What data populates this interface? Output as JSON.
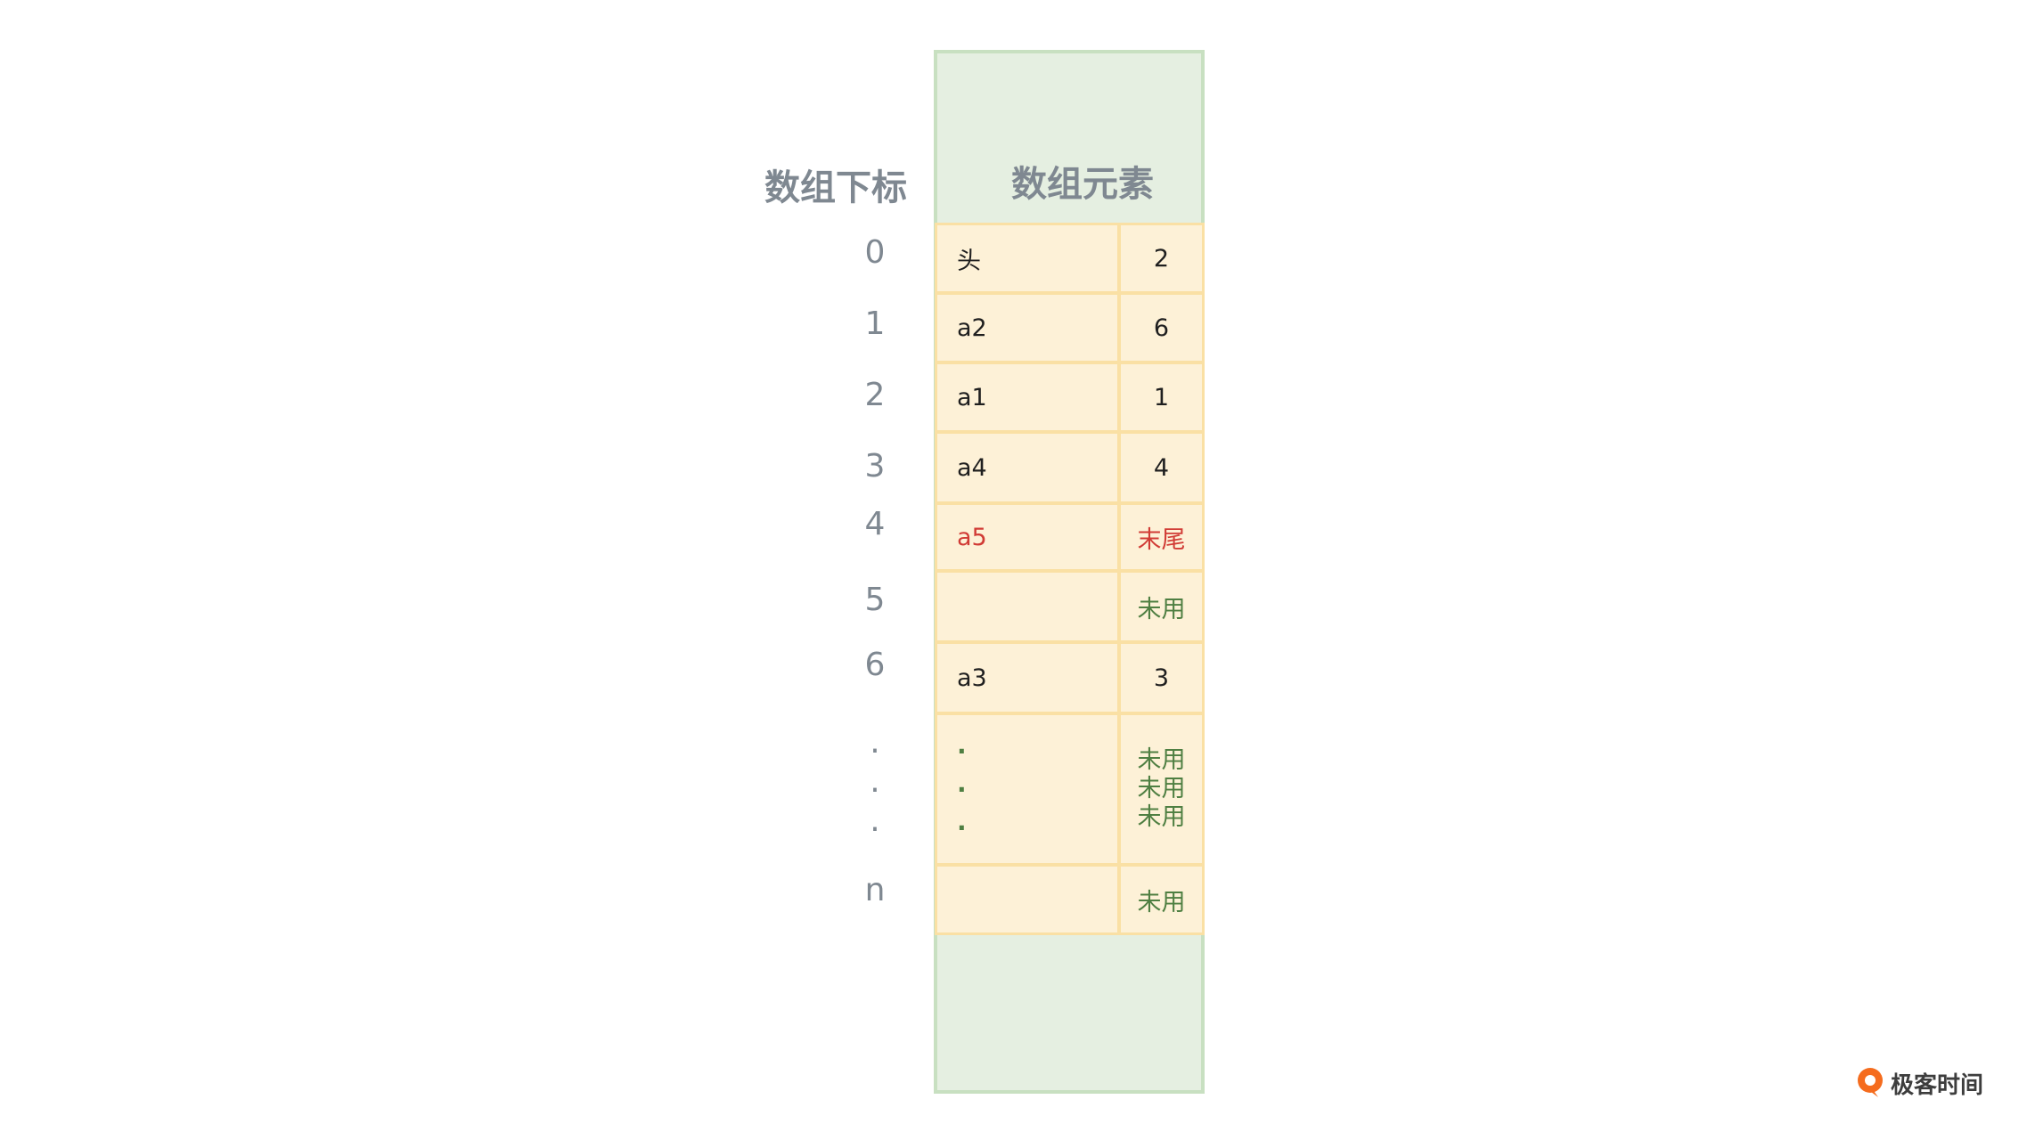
{
  "headers": {
    "index": "数组下标",
    "element": "数组元素"
  },
  "indices": [
    "0",
    "1",
    "2",
    "3",
    "4",
    "5",
    "6",
    "n"
  ],
  "index_dots": [
    "·",
    "·",
    "·"
  ],
  "rows": [
    {
      "data": "头",
      "next": "2",
      "data_color": "default",
      "next_color": "default"
    },
    {
      "data": "a2",
      "next": "6",
      "data_color": "default",
      "next_color": "default"
    },
    {
      "data": "a1",
      "next": "1",
      "data_color": "default",
      "next_color": "default"
    },
    {
      "data": "a4",
      "next": "4",
      "data_color": "default",
      "next_color": "default"
    },
    {
      "data": "a5",
      "next": "末尾",
      "data_color": "red",
      "next_color": "red"
    },
    {
      "data": "",
      "next": "未用",
      "data_color": "default",
      "next_color": "green"
    },
    {
      "data": "a3",
      "next": "3",
      "data_color": "default",
      "next_color": "default"
    }
  ],
  "ellipsis_row": {
    "data_dots": [
      "·",
      "·",
      "·"
    ],
    "next_values": [
      "未用",
      "未用",
      "未用"
    ]
  },
  "last_row": {
    "data": "",
    "next": "未用"
  },
  "colors": {
    "red": "#d13b35",
    "green": "#4f7f42",
    "cell_fill": "#fdf1d7",
    "cell_border": "#fae0a4",
    "frame_fill": "#e5efe1",
    "frame_border": "#c8e0c1",
    "label_gray": "#7f8891"
  },
  "brand": {
    "name": "极客时间",
    "icon": "geektime-logo-icon"
  }
}
